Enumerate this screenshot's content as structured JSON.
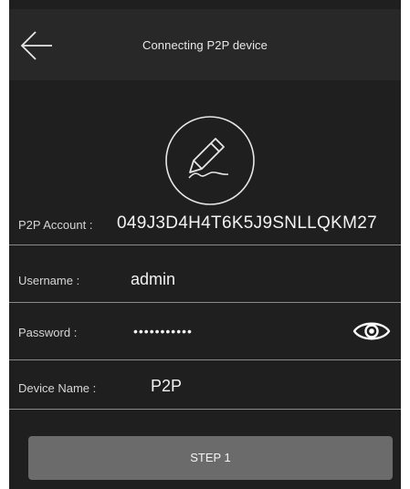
{
  "header": {
    "title": "Connecting P2P device",
    "back_icon": "arrow-left-icon"
  },
  "edit_icon": "pencil-signature-icon",
  "account": {
    "label": "P2P Account :",
    "value": "049J3D4H4T6K5J9SNLLQKM27"
  },
  "username": {
    "label": "Username :",
    "value": "admin"
  },
  "password": {
    "label": "Password :",
    "value": "•••••••••••",
    "toggle_icon": "eye-icon"
  },
  "device_name": {
    "label": "Device Name :",
    "value": "P2P"
  },
  "step_button": {
    "label": "STEP 1"
  },
  "colors": {
    "background": "#1f1f1f",
    "header": "#282828",
    "button": "#6b6b6b",
    "divider": "#8a8a8a",
    "text": "#f2f2f2"
  }
}
